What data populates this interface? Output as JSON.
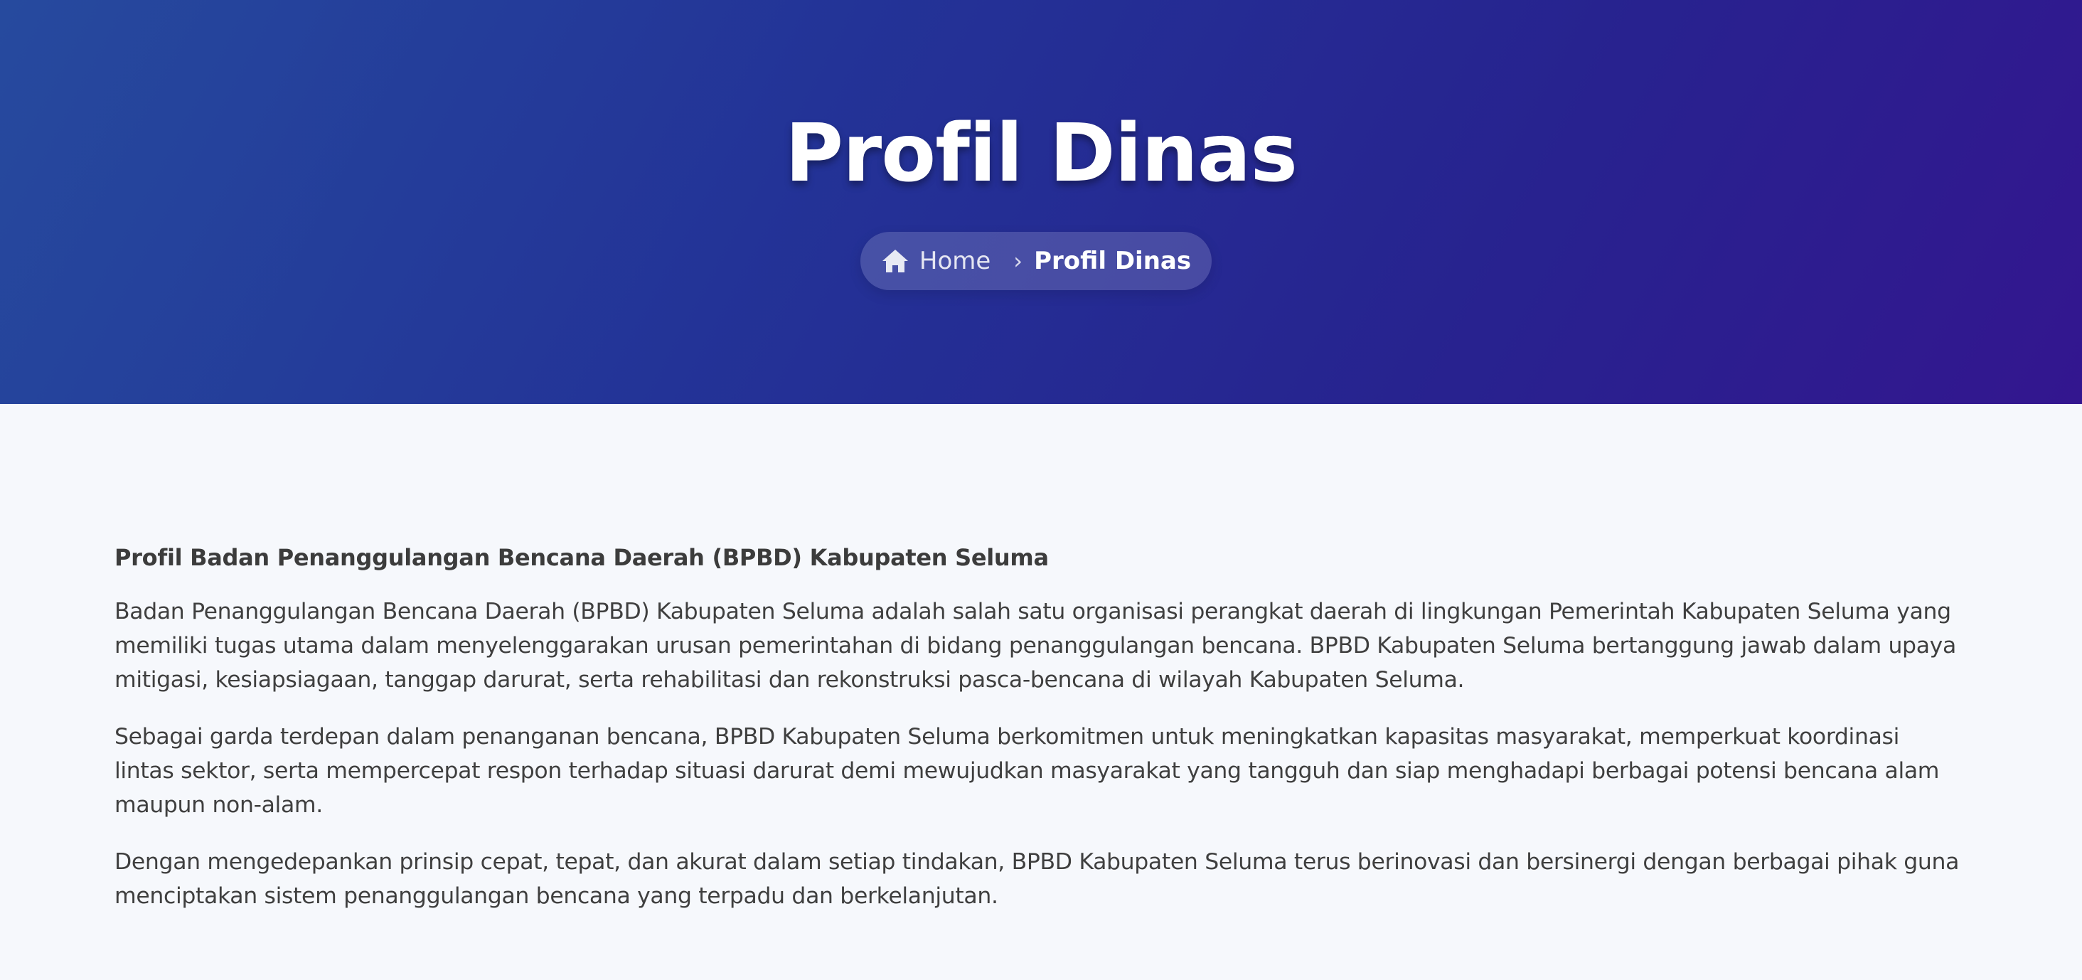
{
  "hero": {
    "title": "Profil Dinas",
    "breadcrumb": {
      "home_icon": "home-icon",
      "home_label": "Home",
      "separator": "›",
      "current_label": "Profil Dinas"
    }
  },
  "content": {
    "heading": "Profil Badan Penanggulangan Bencana Daerah (BPBD) Kabupaten Seluma",
    "paragraphs": [
      "Badan Penanggulangan Bencana Daerah (BPBD) Kabupaten Seluma adalah salah satu organisasi perangkat daerah di lingkungan Pemerintah Kabupaten Seluma yang memiliki tugas utama dalam menyelenggarakan urusan pemerintahan di bidang penanggulangan bencana. BPBD Kabupaten Seluma bertanggung jawab dalam upaya mitigasi, kesiapsiagaan, tanggap darurat, serta rehabilitasi dan rekonstruksi pasca-bencana di wilayah Kabupaten Seluma.",
      "Sebagai garda terdepan dalam penanganan bencana, BPBD Kabupaten Seluma berkomitmen untuk meningkatkan kapasitas masyarakat, memperkuat koordinasi lintas sektor, serta mempercepat respon terhadap situasi darurat demi mewujudkan masyarakat yang tangguh dan siap menghadapi berbagai potensi bencana alam maupun non-alam.",
      "Dengan mengedepankan prinsip cepat, tepat, dan akurat dalam setiap tindakan, BPBD Kabupaten Seluma terus berinovasi dan bersinergi dengan berbagai pihak guna menciptakan sistem penanggulangan bencana yang terpadu dan berkelanjutan."
    ]
  },
  "colors": {
    "hero_gradient_start": "#264a9e",
    "hero_gradient_end": "#33168f",
    "page_background": "#f6f8fc",
    "body_text": "#3f3f3f"
  }
}
